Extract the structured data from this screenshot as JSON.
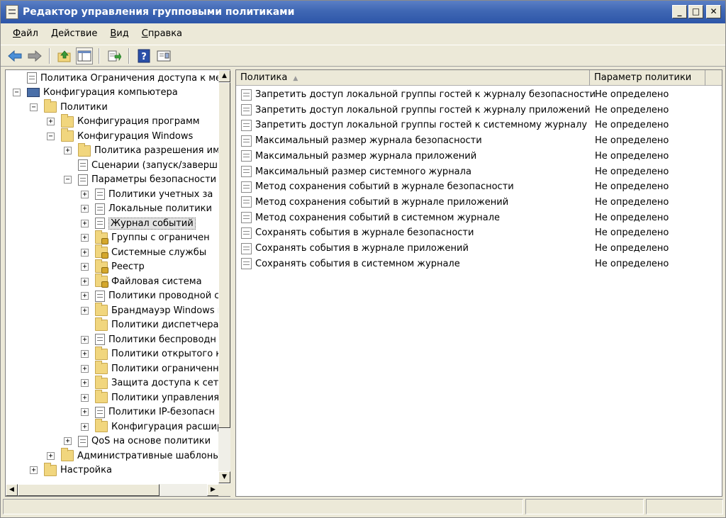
{
  "window": {
    "title": "Редактор управления групповыми политиками"
  },
  "window_controls": {
    "minimize": "_",
    "maximize": "□",
    "close": "✕"
  },
  "menu": [
    {
      "label": "Файл",
      "accel": "Ф"
    },
    {
      "label": "Действие",
      "accel": "Д"
    },
    {
      "label": "Вид",
      "accel": "В"
    },
    {
      "label": "Справка",
      "accel": "С"
    }
  ],
  "toolbar": {
    "buttons": [
      "back-icon",
      "forward-icon",
      "up-folder-icon",
      "show-hide-tree-icon",
      "export-list-icon",
      "help-icon",
      "properties-icon"
    ]
  },
  "tree": {
    "items": [
      {
        "label": "Политика Ограничения доступа к медиа",
        "icon": "policy-doc-icon",
        "expander": "",
        "indent": 0
      },
      {
        "label": "Конфигурация компьютера",
        "icon": "computer-icon",
        "expander": "−",
        "indent": 0
      },
      {
        "label": "Политики",
        "icon": "folder-icon",
        "expander": "−",
        "indent": 1
      },
      {
        "label": "Конфигурация программ",
        "icon": "folder-icon",
        "expander": "+",
        "indent": 2
      },
      {
        "label": "Конфигурация Windows",
        "icon": "folder-icon",
        "expander": "−",
        "indent": 2
      },
      {
        "label": "Политика разрешения име",
        "icon": "folder-icon",
        "expander": "+",
        "indent": 3
      },
      {
        "label": "Сценарии (запуск/заверш",
        "icon": "script-icon",
        "expander": "",
        "indent": 3
      },
      {
        "label": "Параметры безопасности",
        "icon": "security-icon",
        "expander": "−",
        "indent": 3
      },
      {
        "label": "Политики учетных за",
        "icon": "doc-icon",
        "expander": "+",
        "indent": 4
      },
      {
        "label": "Локальные политики",
        "icon": "doc-icon",
        "expander": "+",
        "indent": 4
      },
      {
        "label": "Журнал событий",
        "icon": "doc-icon",
        "expander": "+",
        "indent": 4,
        "selected": true
      },
      {
        "label": "Группы с ограничен",
        "icon": "lock-folder-icon",
        "expander": "+",
        "indent": 4
      },
      {
        "label": "Системные службы",
        "icon": "lock-folder-icon",
        "expander": "+",
        "indent": 4
      },
      {
        "label": "Реестр",
        "icon": "lock-folder-icon",
        "expander": "+",
        "indent": 4
      },
      {
        "label": "Файловая система",
        "icon": "lock-folder-icon",
        "expander": "+",
        "indent": 4
      },
      {
        "label": "Политики проводной с",
        "icon": "network-icon",
        "expander": "+",
        "indent": 4
      },
      {
        "label": "Брандмауэр Windows в",
        "icon": "folder-icon",
        "expander": "+",
        "indent": 4
      },
      {
        "label": "Политики диспетчера",
        "icon": "folder-icon",
        "expander": "",
        "indent": 4
      },
      {
        "label": "Политики беспроводн",
        "icon": "wireless-icon",
        "expander": "+",
        "indent": 4
      },
      {
        "label": "Политики открытого к",
        "icon": "folder-icon",
        "expander": "+",
        "indent": 4
      },
      {
        "label": "Политики ограниченн",
        "icon": "folder-icon",
        "expander": "+",
        "indent": 4
      },
      {
        "label": "Защита доступа к сет",
        "icon": "folder-icon",
        "expander": "+",
        "indent": 4
      },
      {
        "label": "Политики управления",
        "icon": "folder-icon",
        "expander": "+",
        "indent": 4
      },
      {
        "label": "Политики IP-безопасн",
        "icon": "ipsec-icon",
        "expander": "+",
        "indent": 4
      },
      {
        "label": "Конфигурация расшир",
        "icon": "folder-icon",
        "expander": "+",
        "indent": 4
      },
      {
        "label": "QoS на основе политики",
        "icon": "qos-chart-icon",
        "expander": "+",
        "indent": 3
      },
      {
        "label": "Административные шаблоны",
        "icon": "folder-icon",
        "expander": "+",
        "indent": 2
      },
      {
        "label": "Настройка",
        "icon": "folder-icon",
        "expander": "+",
        "indent": 1
      }
    ]
  },
  "list": {
    "columns": [
      "Политика",
      "Параметр политики"
    ],
    "rows": [
      {
        "name": "Запретить доступ локальной группы гостей к журналу безопасности",
        "value": "Не определено"
      },
      {
        "name": "Запретить доступ локальной группы гостей к журналу приложений",
        "value": "Не определено"
      },
      {
        "name": "Запретить доступ локальной группы гостей к системному журналу",
        "value": "Не определено"
      },
      {
        "name": "Максимальный размер журнала безопасности",
        "value": "Не определено"
      },
      {
        "name": "Максимальный размер журнала приложений",
        "value": "Не определено"
      },
      {
        "name": "Максимальный размер системного журнала",
        "value": "Не определено"
      },
      {
        "name": "Метод сохранения событий в журнале безопасности",
        "value": "Не определено"
      },
      {
        "name": "Метод сохранения событий в журнале приложений",
        "value": "Не определено"
      },
      {
        "name": "Метод сохранения событий в системном журнале",
        "value": "Не определено"
      },
      {
        "name": "Сохранять события в журнале безопасности",
        "value": "Не определено"
      },
      {
        "name": "Сохранять события в журнале приложений",
        "value": "Не определено"
      },
      {
        "name": "Сохранять события в системном журнале",
        "value": "Не определено"
      }
    ]
  },
  "colors": {
    "titlebar": "#3f67b4",
    "folder": "#f1d67e",
    "window_bg": "#ece9d8"
  }
}
